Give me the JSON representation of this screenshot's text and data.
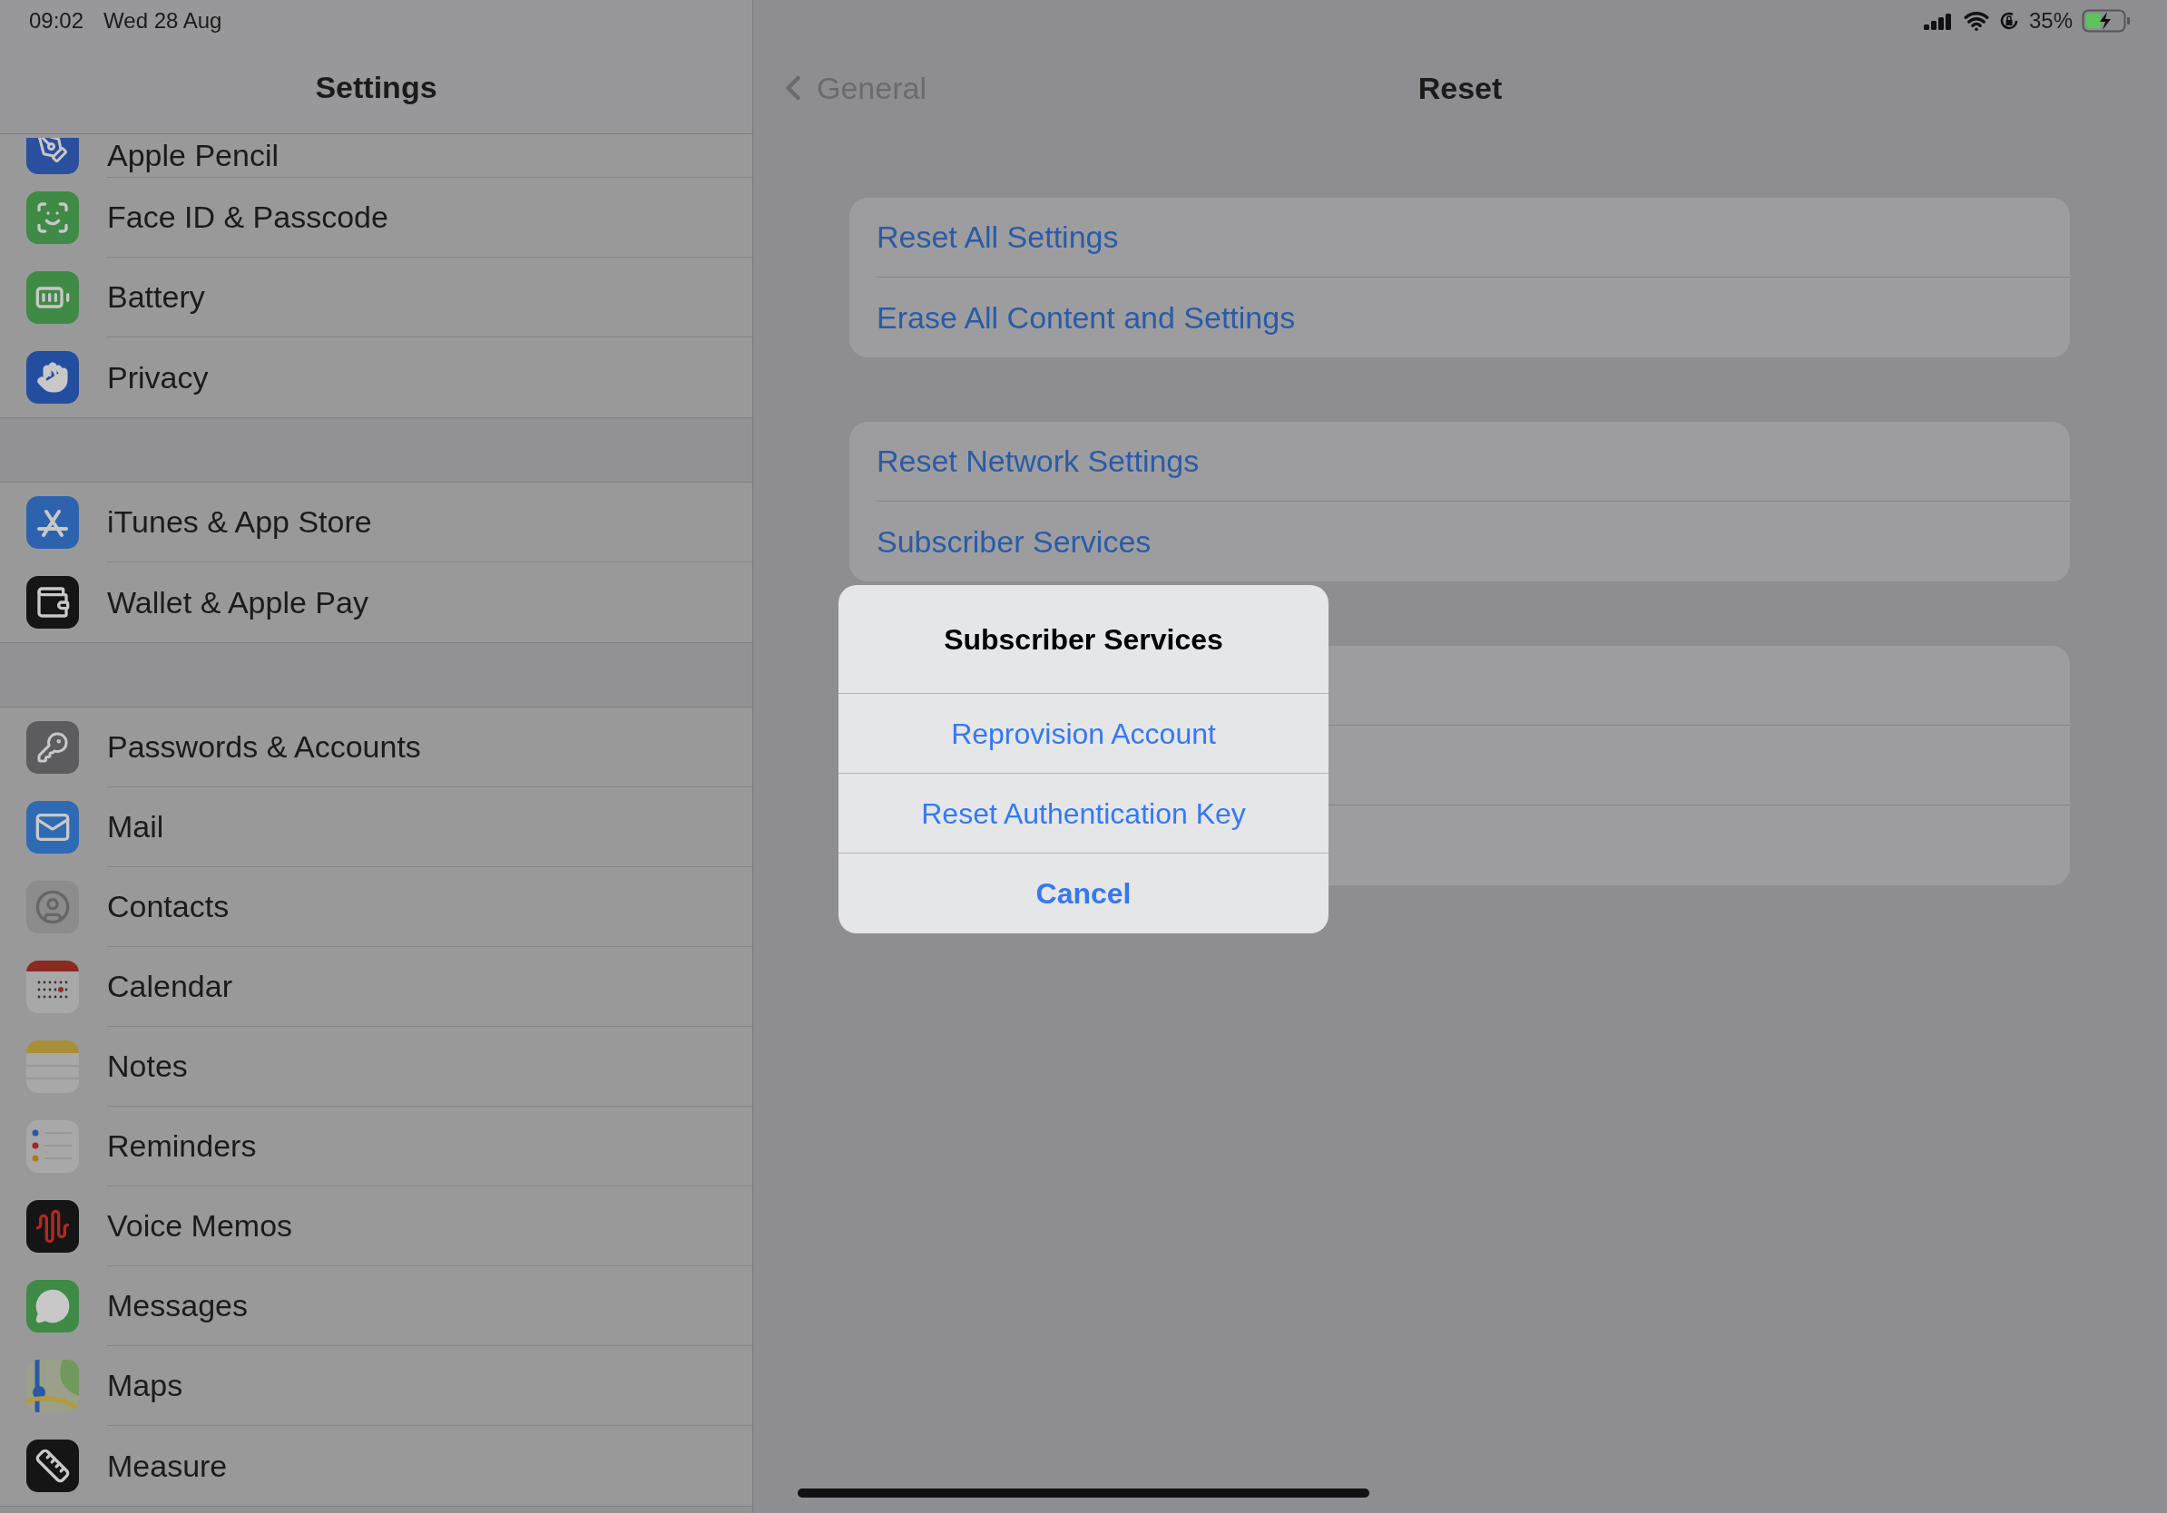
{
  "status_bar": {
    "time": "09:02",
    "date": "Wed 28 Aug",
    "battery": "35%"
  },
  "sidebar": {
    "title": "Settings",
    "groups": [
      {
        "items": [
          {
            "label": "Apple Pencil"
          },
          {
            "label": "Face ID & Passcode"
          },
          {
            "label": "Battery"
          },
          {
            "label": "Privacy"
          }
        ]
      },
      {
        "items": [
          {
            "label": "iTunes & App Store"
          },
          {
            "label": "Wallet & Apple Pay"
          }
        ]
      },
      {
        "items": [
          {
            "label": "Passwords & Accounts"
          },
          {
            "label": "Mail"
          },
          {
            "label": "Contacts"
          },
          {
            "label": "Calendar"
          },
          {
            "label": "Notes"
          },
          {
            "label": "Reminders"
          },
          {
            "label": "Voice Memos"
          },
          {
            "label": "Messages"
          },
          {
            "label": "Maps"
          },
          {
            "label": "Measure"
          }
        ]
      }
    ]
  },
  "detail": {
    "back": "General",
    "title": "Reset",
    "groups": [
      {
        "rows": [
          {
            "label": "Reset All Settings"
          },
          {
            "label": "Erase All Content and Settings"
          }
        ]
      },
      {
        "rows": [
          {
            "label": "Reset Network Settings"
          },
          {
            "label": "Subscriber Services"
          }
        ]
      }
    ]
  },
  "alert": {
    "title": "Subscriber Services",
    "actions": [
      {
        "label": "Reprovision Account",
        "kind": "default"
      },
      {
        "label": "Reset Authentication Key",
        "kind": "default"
      },
      {
        "label": "Cancel",
        "kind": "cancel"
      }
    ]
  }
}
